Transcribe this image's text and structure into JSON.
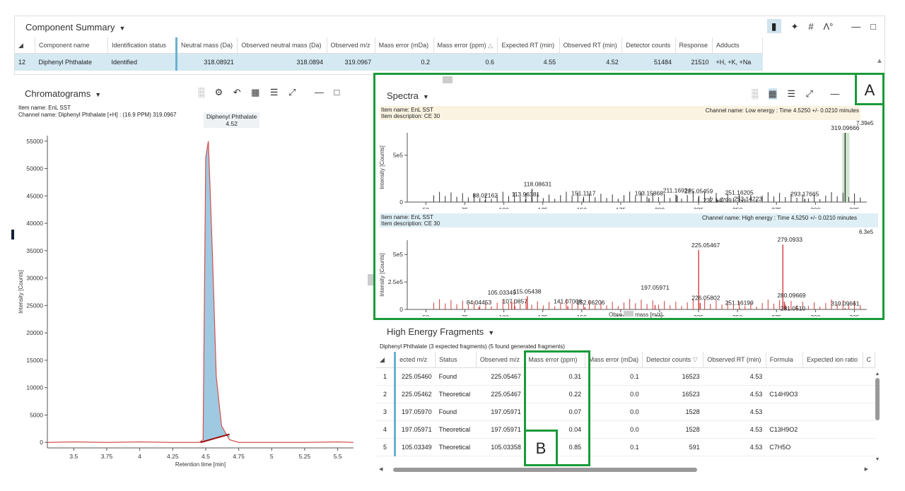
{
  "summary": {
    "title": "Component Summary",
    "toolbar": [
      "beaker-icon",
      "share-icon",
      "hash-icon",
      "spectrum-tool-icon"
    ],
    "columns": [
      "Component name",
      "Identification status",
      "Neutral mass (Da)",
      "Observed neutral mass (Da)",
      "Observed m/z",
      "Mass error (mDa)",
      "Mass error (ppm)",
      "Expected RT (min)",
      "Observed RT (min)",
      "Detector counts",
      "Response",
      "Adducts"
    ],
    "row": {
      "index": "12",
      "name": "Diphenyl Phthalate",
      "status": "Identified",
      "neutral_mass": "318.08921",
      "obs_neutral": "318.0894",
      "obs_mz": "319.0967",
      "err_mda": "0.2",
      "err_ppm": "0.6",
      "exp_rt": "4.55",
      "obs_rt": "4.52",
      "counts": "51484",
      "response": "21510",
      "adducts": "+H, +K, +Na"
    }
  },
  "chromatograms": {
    "title": "Chromatograms",
    "item_name": "Item name: EnL SST",
    "channel": "Channel name: Diphenyl Phthalate [+H] : (16.9 PPM) 319.0967",
    "peak_label": "Diphenyl Phthalate",
    "peak_rt": "4.52",
    "ylabel": "Intensity [Counts]",
    "xlabel": "Retention time [min]",
    "yticks": [
      "55000",
      "50000",
      "45000",
      "40000",
      "35000",
      "30000",
      "25000",
      "20000",
      "15000",
      "10000",
      "5000",
      "0"
    ],
    "xticks": [
      "3.5",
      "3.75",
      "4",
      "4.25",
      "4.5",
      "4.75",
      "5",
      "5.25",
      "5.5"
    ]
  },
  "spectra": {
    "title": "Spectra",
    "low": {
      "item_name": "Item name: EnL SST",
      "item_desc": "Item description: CE 30",
      "channel": "Channel name: Low energy : Time 4.5250 +/- 0.0210 minutes",
      "max": "7.39e5",
      "yticks": [
        "5e5",
        "0"
      ],
      "ylabel": "Intensity [Counts]"
    },
    "high": {
      "item_name": "Item name: EnL SST",
      "item_desc": "Item description: CE 30",
      "channel": "Channel name: High energy : Time 4.5250 +/- 0.0210 minutes",
      "max": "6.3e5",
      "yticks": [
        "5e5",
        "2.5e5",
        "0"
      ],
      "ylabel": "Intensity [Counts]"
    },
    "xticks": [
      "50",
      "75",
      "100",
      "125",
      "150",
      "175",
      "200",
      "225",
      "250",
      "275",
      "300",
      "325"
    ],
    "xlabel_left": "Obse",
    "xlabel_right": "mass [m/z]"
  },
  "chart_data": [
    {
      "type": "line",
      "title": "",
      "xlabel": "Retention time [min]",
      "ylabel": "Intensity [Counts]",
      "xlim": [
        3.3,
        5.62
      ],
      "ylim": [
        -1000,
        56000
      ],
      "series": [
        {
          "name": "Diphenyl Phthalate [+H]",
          "x": [
            3.3,
            3.5,
            3.75,
            4.0,
            4.25,
            4.45,
            4.48,
            4.5,
            4.52,
            4.55,
            4.58,
            4.62,
            4.68,
            4.75,
            5.0,
            5.25,
            5.5,
            5.62
          ],
          "y": [
            0,
            100,
            0,
            100,
            0,
            0,
            500,
            52000,
            55000,
            35000,
            12000,
            3000,
            500,
            0,
            0,
            0,
            100,
            0
          ]
        }
      ]
    },
    {
      "type": "bar",
      "title": "",
      "ylabel": "Intensity [Counts]",
      "xlim": [
        38,
        333
      ],
      "ylim": [
        0,
        739000
      ],
      "x": [
        88.02162,
        113.96381,
        118.08631,
        151.1117,
        193.15868,
        211.16924,
        225.05459,
        237.14799,
        251.16205,
        253.14223,
        293.17665,
        319.09666
      ],
      "values": [
        20000,
        30000,
        140000,
        40000,
        40000,
        70000,
        50000,
        25000,
        50000,
        25000,
        35000,
        739000
      ]
    },
    {
      "type": "bar",
      "title": "",
      "xlabel": "Observed mass [m/z]",
      "ylabel": "Intensity [Counts]",
      "xlim": [
        38,
        333
      ],
      "ylim": [
        0,
        630000
      ],
      "x": [
        84.04453,
        105.03349,
        107.0857,
        115.05438,
        141.07008,
        152.06206,
        197.05971,
        225.05467,
        226.05802,
        251.16199,
        279.0933,
        280.09669,
        281.051,
        319.09661
      ],
      "values": [
        20000,
        70000,
        30000,
        120000,
        30000,
        20000,
        40000,
        540000,
        60000,
        15000,
        590000,
        70000,
        30000,
        10000
      ]
    }
  ],
  "fragments": {
    "title": "High Energy Fragments",
    "subtitle": "Diphenyl Phthalate (3 expected fragments) (5 found generated fragments)",
    "columns": [
      "ected m/z",
      "Status",
      "Observed m/z",
      "Mass error (ppm)",
      "Mass error (mDa)",
      "Detector counts",
      "Observed RT (min)",
      "Formula",
      "Expected ion ratio",
      "C"
    ],
    "rows": [
      {
        "i": "1",
        "exp": "225.05460",
        "status": "Found",
        "obs": "225.05467",
        "ppm": "0.31",
        "mda": "0.1",
        "counts": "16523",
        "rt": "4.53",
        "formula": ""
      },
      {
        "i": "2",
        "exp": "225.05462",
        "status": "Theoretical",
        "obs": "225.05467",
        "ppm": "0.22",
        "mda": "0.0",
        "counts": "16523",
        "rt": "4.53",
        "formula": "C14H9O3"
      },
      {
        "i": "3",
        "exp": "197.05970",
        "status": "Found",
        "obs": "197.05971",
        "ppm": "0.07",
        "mda": "0.0",
        "counts": "1528",
        "rt": "4.53",
        "formula": ""
      },
      {
        "i": "4",
        "exp": "197.05971",
        "status": "Theoretical",
        "obs": "197.05971",
        "ppm": "0.04",
        "mda": "0.0",
        "counts": "1528",
        "rt": "4.53",
        "formula": "C13H9O2"
      },
      {
        "i": "5",
        "exp": "105.03349",
        "status": "Theoretical",
        "obs": "105.03358",
        "ppm": "0.85",
        "mda": "0.1",
        "counts": "591",
        "rt": "4.53",
        "formula": "C7H5O"
      }
    ]
  },
  "annotations": {
    "a": "A",
    "b": "B",
    "highlight_color": "#1a9a3a"
  }
}
